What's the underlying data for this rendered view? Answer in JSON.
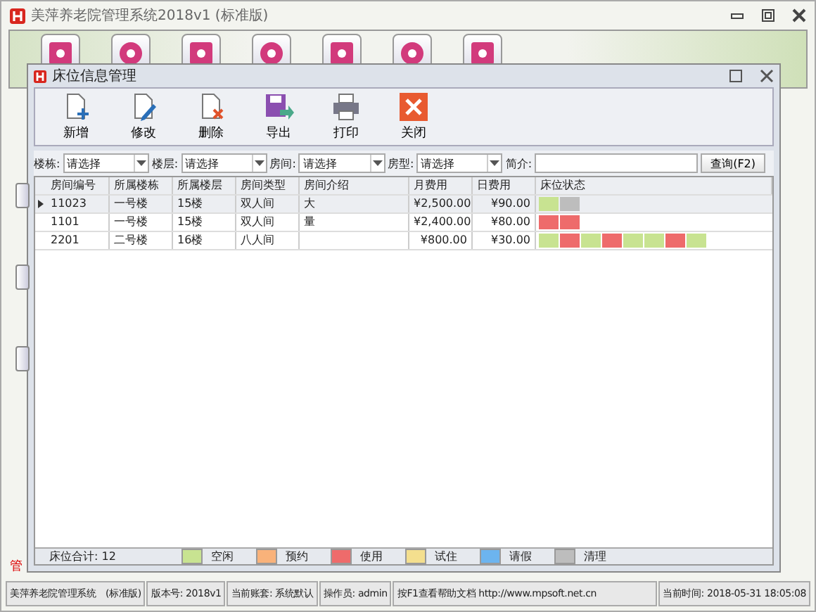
{
  "window": {
    "title": "美萍养老院管理系统2018v1 (标准版)"
  },
  "side_label": "管",
  "child_window": {
    "title": "床位信息管理"
  },
  "toolbar": [
    "新增",
    "修改",
    "删除",
    "导出",
    "打印",
    "关闭"
  ],
  "filters": [
    {
      "label": "楼栋:",
      "value": "请选择",
      "kind": "select"
    },
    {
      "label": "楼层:",
      "value": "请选择",
      "kind": "select"
    },
    {
      "label": "房间:",
      "value": "请选择",
      "kind": "select"
    },
    {
      "label": "房型:",
      "value": "请选择",
      "kind": "select"
    },
    {
      "label": "简介:",
      "kind": "text"
    }
  ],
  "query_button": "查询(F2)",
  "table": {
    "columns": [
      "房间编号",
      "所属楼栋",
      "所属楼层",
      "房间类型",
      "房间介绍",
      "月费用",
      "日费用",
      "床位状态"
    ],
    "rows": [
      {
        "selected": true,
        "cells": [
          "11023",
          "一号楼",
          "15楼",
          "双人间",
          "大",
          "¥2,500.00",
          "¥90.00"
        ],
        "beds": [
          {
            "color": "#c8e391"
          },
          {
            "color": "#bdbdbd"
          }
        ]
      },
      {
        "selected": false,
        "cells": [
          "1101",
          "一号楼",
          "15楼",
          "双人间",
          "量",
          "¥2,400.00",
          "¥80.00"
        ],
        "beds": [
          {
            "color": "#ee6b6b"
          },
          {
            "color": "#ee6b6b"
          }
        ]
      },
      {
        "selected": false,
        "cells": [
          "2201",
          "二号楼",
          "16楼",
          "八人间",
          "",
          "¥800.00",
          "¥30.00"
        ],
        "beds": [
          {
            "color": "#c8e391"
          },
          {
            "color": "#ee6b6b"
          },
          {
            "color": "#c8e391"
          },
          {
            "color": "#ee6b6b"
          },
          {
            "color": "#c8e391"
          },
          {
            "color": "#c8e391"
          },
          {
            "color": "#ee6b6b"
          },
          {
            "color": "#c8e391"
          }
        ]
      }
    ]
  },
  "bed_total": "床位合计: 12",
  "legend": [
    {
      "label": "空闲",
      "color": "#c8e391"
    },
    {
      "label": "预约",
      "color": "#f9b27a"
    },
    {
      "label": "使用",
      "color": "#ee6b6b"
    },
    {
      "label": "试住",
      "color": "#f4df8e"
    },
    {
      "label": "请假",
      "color": "#6cb4ef"
    },
    {
      "label": "清理",
      "color": "#bdbdbd"
    }
  ],
  "status_bar": [
    "美萍养老院管理系统　(标准版)",
    "版本号: 2018v1",
    "当前账套: 系统默认",
    "操作员: admin",
    "按F1查看帮助文档 http://www.mpsoft.net.cn",
    "当前时间: 2018-05-31 18:05:08"
  ]
}
